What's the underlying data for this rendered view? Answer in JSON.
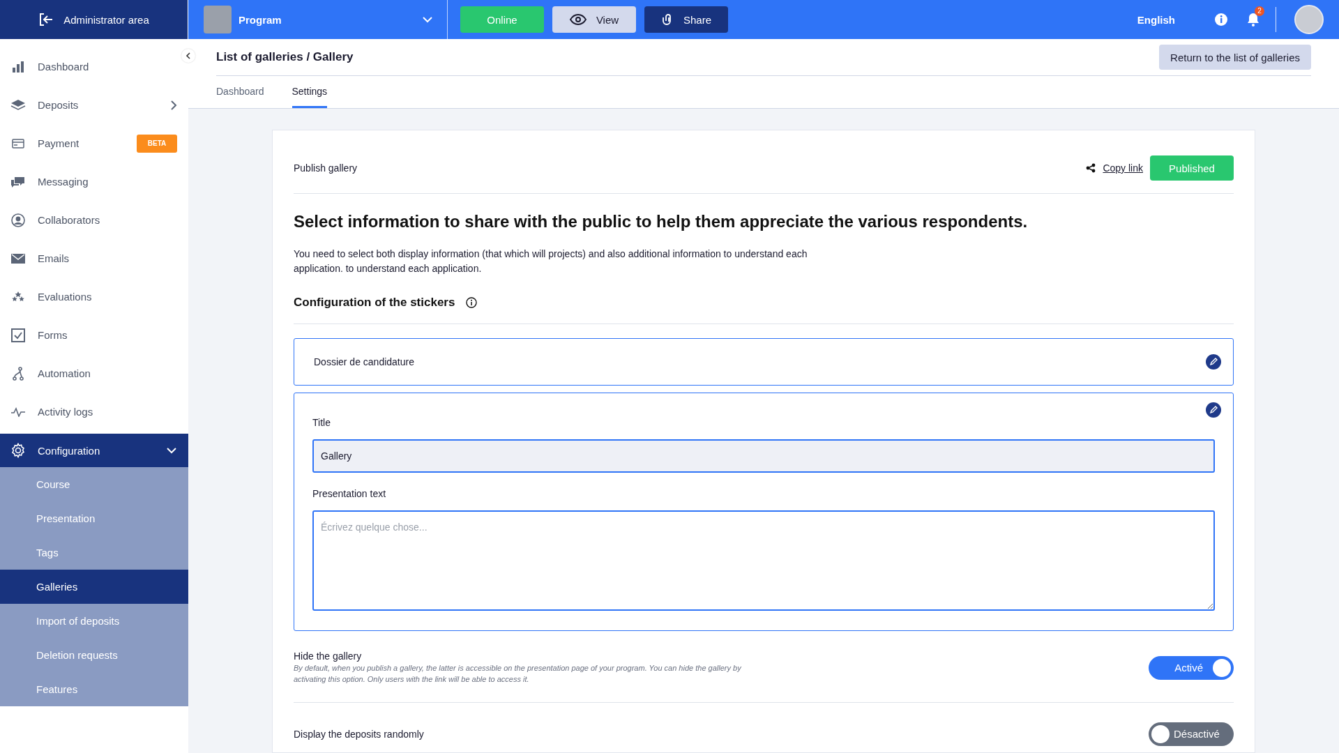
{
  "topbar": {
    "admin_label": "Administrator area",
    "program": "Program",
    "buttons": [
      {
        "kind": "online",
        "label": "Online"
      },
      {
        "kind": "view",
        "label": "View"
      },
      {
        "kind": "share",
        "label": "Share"
      }
    ],
    "language": "English",
    "notification_count": "2"
  },
  "sidebar": {
    "items": [
      {
        "kind": "chart",
        "label": "Dashboard",
        "selected": false
      },
      {
        "kind": "layers",
        "label": "Deposits",
        "selected": false,
        "arrow": true
      },
      {
        "kind": "card",
        "label": "Payment",
        "selected": false,
        "badge": "BETA"
      },
      {
        "kind": "chat",
        "label": "Messaging",
        "selected": false
      },
      {
        "kind": "person",
        "label": "Collaborators",
        "selected": false
      },
      {
        "kind": "mail",
        "label": "Emails",
        "selected": false
      },
      {
        "kind": "stars",
        "label": "Evaluations",
        "selected": false
      },
      {
        "kind": "check",
        "label": "Forms",
        "selected": false
      },
      {
        "kind": "flow",
        "label": "Automation",
        "selected": false
      },
      {
        "kind": "pulse",
        "label": "Activity logs",
        "selected": false
      },
      {
        "kind": "gear",
        "label": "Configuration",
        "selected": true,
        "expanded": true,
        "children": [
          {
            "label": "Course",
            "selected": false
          },
          {
            "label": "Presentation",
            "selected": false
          },
          {
            "label": "Tags",
            "selected": false
          },
          {
            "label": "Galleries",
            "selected": true
          },
          {
            "label": "Import of deposits",
            "selected": false
          },
          {
            "label": "Deletion requests",
            "selected": false
          },
          {
            "label": "Features",
            "selected": false
          }
        ]
      }
    ]
  },
  "header": {
    "breadcrumb": "List of galleries / Gallery",
    "return_button": "Return to the list of galleries",
    "tabs": [
      {
        "label": "Dashboard",
        "selected": false
      },
      {
        "label": "Settings",
        "selected": true
      }
    ]
  },
  "card": {
    "publish_label": "Publish gallery",
    "copy_link": "Copy link",
    "status": "Published",
    "heading": "Select information to share with the public to help them appreciate the various respondents.",
    "intro": "You need to select both display information (that which will projects) and also additional information to understand each application. to understand each application.",
    "stickers_heading": "Configuration of the stickers",
    "section_title": "Dossier de candidature",
    "title_label": "Title",
    "title_value": "Gallery",
    "text_label": "Presentation text",
    "text_placeholder": "Écrivez quelque chose...",
    "toggles": [
      {
        "label": "Hide the gallery",
        "description": "By default, when you publish a gallery, the latter is accessible on the presentation page of your program. You can hide the gallery by activating this option. Only users with the link will be able to access it.",
        "on": true,
        "state_label": "Activé"
      },
      {
        "label": "Display the deposits randomly",
        "on": false,
        "state_label": "Désactivé"
      }
    ]
  }
}
